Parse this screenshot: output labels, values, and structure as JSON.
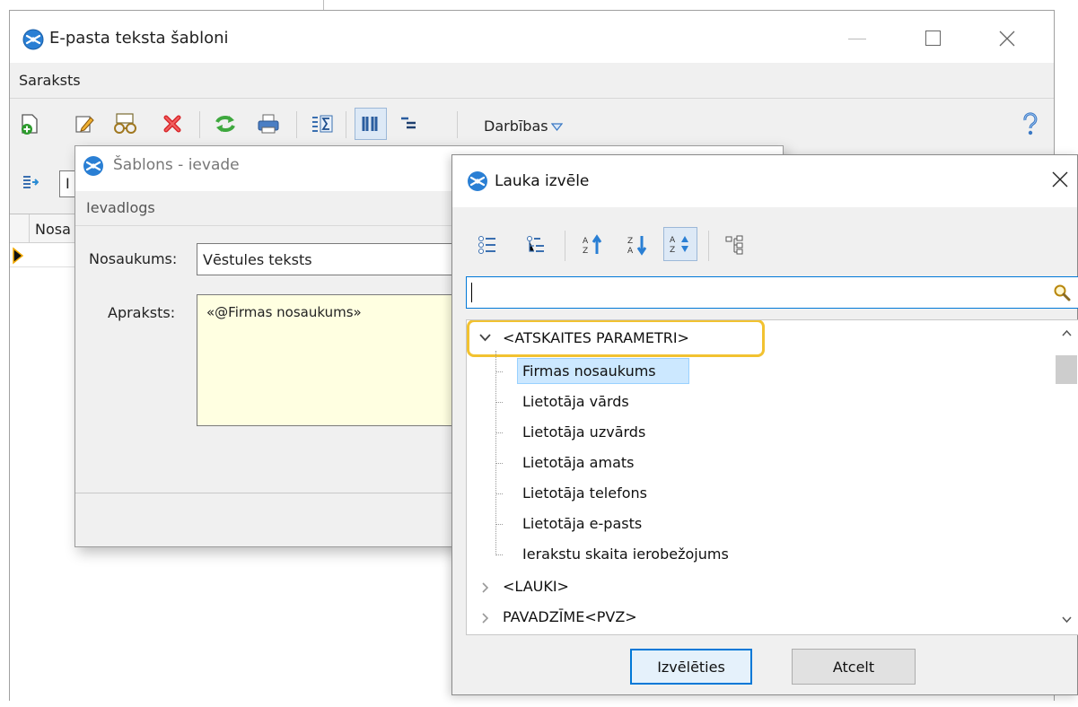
{
  "main_window": {
    "title": "E-pasta teksta šabloni",
    "menu_label": "Saraksts",
    "toolbar": {
      "actions_label": "Darbības",
      "icons": [
        "new-doc-icon",
        "edit-pencil-icon",
        "view-glasses-icon",
        "delete-x-icon",
        "refresh-icon",
        "print-icon",
        "sum-icon",
        "columns-icon",
        "tree-indent-icon",
        "dropdown-triangle-icon",
        "help-question-icon"
      ]
    },
    "filter_prefix": "I",
    "table_header": "Nosa"
  },
  "entry_dialog": {
    "title": "Šablons - ievade",
    "tab_label": "Ievadlogs",
    "name_label": "Nosaukums:",
    "name_value": "Vēstules teksts",
    "description_label": "Apraksts:",
    "description_value": "«@Firmas nosaukums»",
    "colors": {
      "description_bg": "#ffffe1"
    }
  },
  "field_dialog": {
    "title": "Lauka izvēle",
    "search": {
      "value": ""
    },
    "tree": {
      "groups": [
        {
          "label": "<ATSKAITES PARAMETRI>",
          "expanded": true,
          "highlighted": true,
          "children": [
            "Firmas nosaukums",
            "Lietotāja vārds",
            "Lietotāja uzvārds",
            "Lietotāja amats",
            "Lietotāja telefons",
            "Lietotāja e-pasts",
            "Ierakstu skaita ierobežojums"
          ],
          "selected_child": 0
        },
        {
          "label": "<LAUKI>",
          "expanded": false
        },
        {
          "label": "PAVADZĪME<PVZ>",
          "expanded": false
        }
      ]
    },
    "select_button": "Izvēlēties",
    "cancel_button": "Atcelt",
    "colors": {
      "highlight_ring": "#f2c230",
      "selection": "#cce8ff",
      "focus_border": "#0078d7"
    }
  }
}
